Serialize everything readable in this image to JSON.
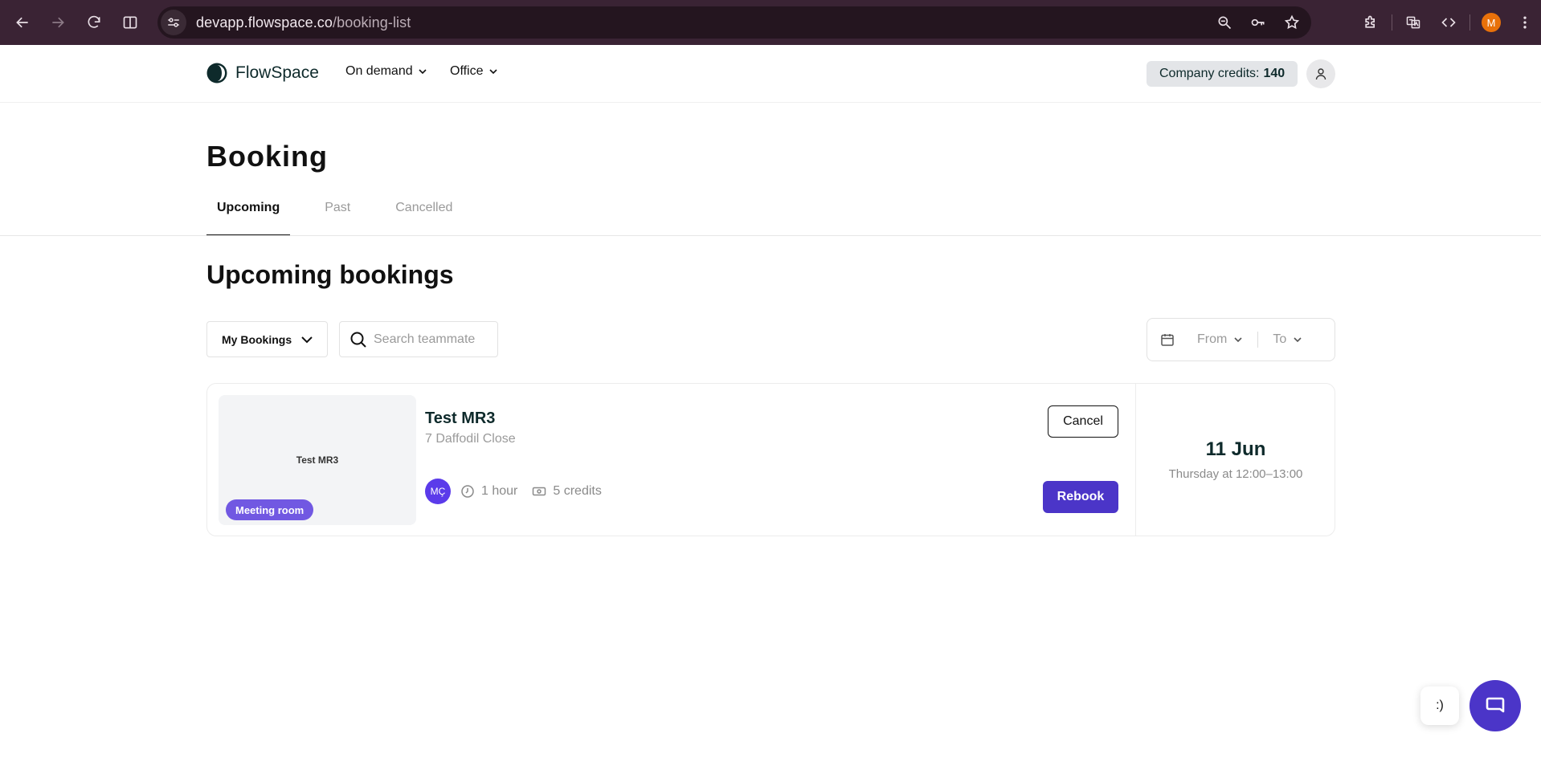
{
  "browser": {
    "url_host": "devapp.flowspace.co",
    "url_path": "/booking-list",
    "profile_initial": "M"
  },
  "header": {
    "brand": "FlowSpace",
    "menus": [
      {
        "label": "On demand"
      },
      {
        "label": "Office"
      }
    ],
    "credits_label": "Company credits:",
    "credits_value": "140"
  },
  "page": {
    "title": "Booking",
    "tabs": [
      {
        "label": "Upcoming",
        "active": true
      },
      {
        "label": "Past",
        "active": false
      },
      {
        "label": "Cancelled",
        "active": false
      }
    ],
    "section_title": "Upcoming bookings"
  },
  "filters": {
    "scope_selected": "My Bookings",
    "search_placeholder": "Search teammate",
    "from_label": "From",
    "to_label": "To"
  },
  "bookings": [
    {
      "thumb_label": "Test MR3",
      "type_badge": "Meeting room",
      "name": "Test MR3",
      "address": "7 Daffodil Close",
      "avatar_initials": "MÇ",
      "duration": "1 hour",
      "credits": "5 credits",
      "cancel_label": "Cancel",
      "rebook_label": "Rebook",
      "date": "11 Jun",
      "time": "Thursday at 12:00–13:00"
    }
  ],
  "floating": {
    "smiley": ":)"
  },
  "colors": {
    "primary": "#4b35c8",
    "badge": "#7158e2",
    "browser_frame": "#3a2334"
  }
}
